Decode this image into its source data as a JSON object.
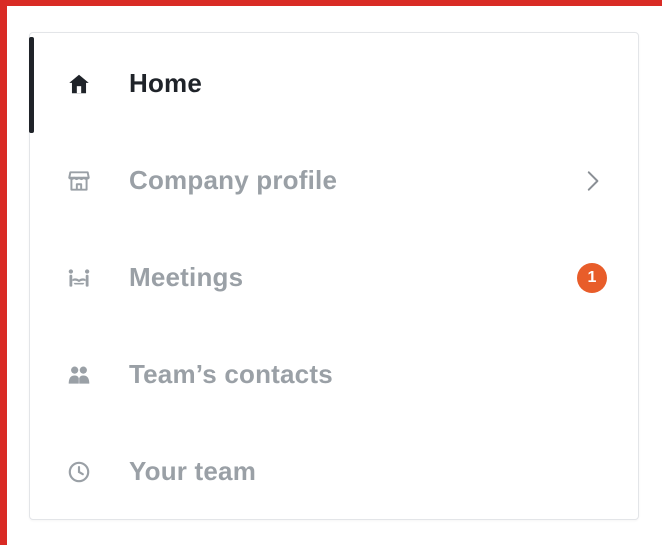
{
  "colors": {
    "frame": "#d92b25",
    "active_text": "#1f2329",
    "inactive_text": "#9aa0a6",
    "badge": "#e85d2a"
  },
  "nav": {
    "items": [
      {
        "label": "Home",
        "icon": "home-icon",
        "active": true
      },
      {
        "label": "Company profile",
        "icon": "storefront-icon",
        "has_submenu": true
      },
      {
        "label": "Meetings",
        "icon": "handshake-icon",
        "badge": "1"
      },
      {
        "label": "Team’s contacts",
        "icon": "people-icon"
      },
      {
        "label": "Your team",
        "icon": "clock-icon"
      }
    ]
  }
}
